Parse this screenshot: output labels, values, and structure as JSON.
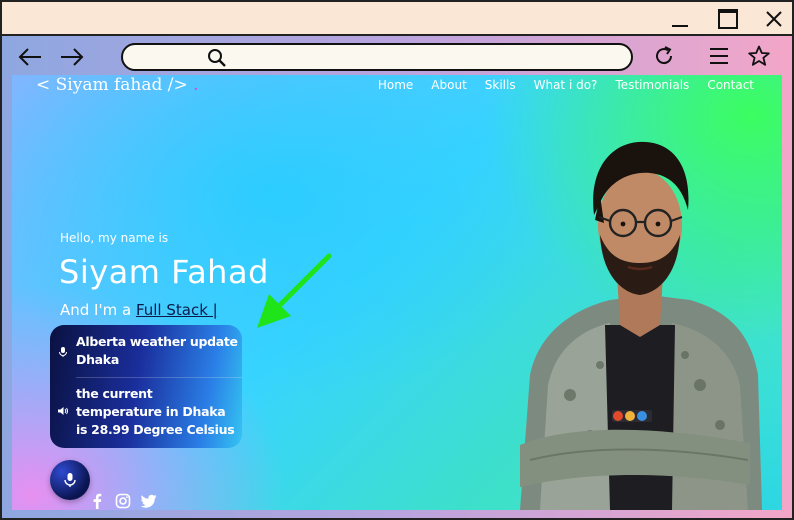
{
  "browser": {
    "address_value": ""
  },
  "site": {
    "logo": "< Siyam fahad />",
    "logo_dot": ".",
    "nav": [
      "Home",
      "About",
      "Skills",
      "What i do?",
      "Testimonials",
      "Contact"
    ]
  },
  "hero": {
    "greeting": "Hello, my name is",
    "name": "Siyam Fahad",
    "intro_prefix": "And I'm a ",
    "role": "Full Stack |"
  },
  "assistant": {
    "user_message": "Alberta weather update Dhaka",
    "reply_message": "the current temperature in Dhaka is 28.99 Degree Celsius"
  },
  "icons": {
    "back": "arrow-left-icon",
    "forward": "arrow-right-icon",
    "search": "search-icon",
    "reload": "reload-icon",
    "menu": "menu-icon",
    "bookmark": "star-icon",
    "user_row": "mic-icon",
    "reply_row": "speaker-icon",
    "social": [
      "facebook-icon",
      "instagram-icon",
      "twitter-icon"
    ]
  },
  "colors": {
    "accent_dot": "#e83ad6",
    "role_link": "#0b1a4a",
    "annotation_arrow": "#1fe41a"
  }
}
